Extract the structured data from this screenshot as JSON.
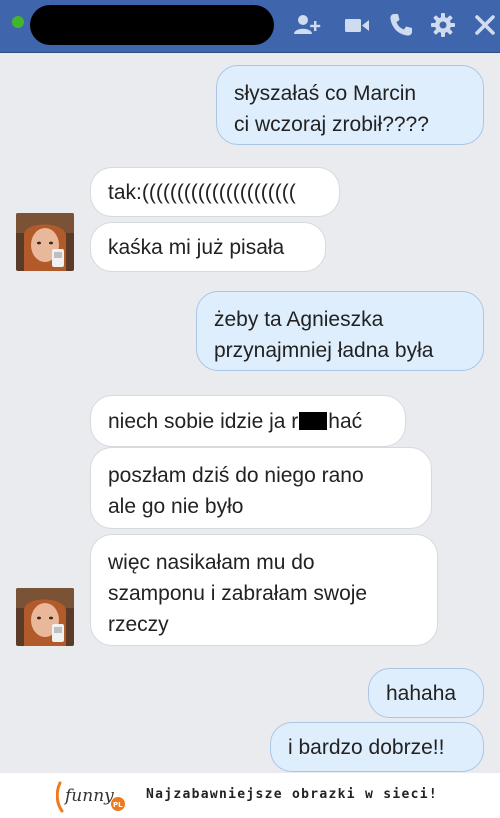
{
  "header": {
    "contact_name_redacted": true,
    "icons": [
      "add-friend-icon",
      "video-call-icon",
      "phone-icon",
      "gear-icon",
      "close-icon"
    ],
    "accent": "#3f65ad",
    "online_color": "#42b72a"
  },
  "messages": [
    {
      "side": "sent",
      "lines": [
        "słyszałaś co Marcin",
        "ci wczoraj zrobił????"
      ]
    },
    {
      "side": "received",
      "lines": [
        "tak:(((((((((((((((((((((("
      ]
    },
    {
      "side": "received",
      "lines": [
        "kaśka mi już pisała"
      ]
    },
    {
      "side": "sent",
      "lines": [
        "żeby ta Agnieszka",
        "przynajmniej ładna była"
      ]
    },
    {
      "side": "received",
      "text_before": "niech sobie idzie ja r",
      "text_after": "hać",
      "censored": true
    },
    {
      "side": "received",
      "lines": [
        "poszłam dziś do niego rano",
        "ale go nie było"
      ]
    },
    {
      "side": "received",
      "lines": [
        "więc nasikałam mu do",
        "szamponu i zabrałam swoje",
        "rzeczy"
      ]
    },
    {
      "side": "sent",
      "lines": [
        "hahaha"
      ]
    },
    {
      "side": "sent",
      "lines": [
        "i bardzo dobrze!!"
      ]
    }
  ],
  "footer": {
    "logo_text": "funny",
    "logo_suffix": "PL",
    "tagline": "Najzabawniejsze obrazki w sieci!"
  },
  "colors": {
    "chat_background": "#e9ebee",
    "sent_bubble": "#dfeefc",
    "received_bubble": "#ffffff"
  }
}
